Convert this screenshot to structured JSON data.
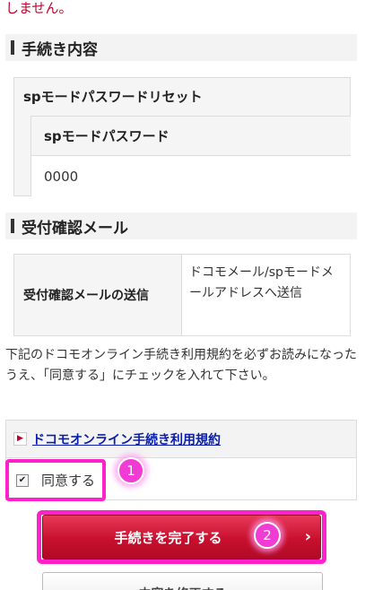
{
  "top_text": "しません。",
  "procedure_section": {
    "heading": "手続き内容",
    "item_title": "spモードパスワードリセット",
    "sub_title": "spモードパスワード",
    "sub_value": "0000"
  },
  "confirmation_section": {
    "heading": "受付確認メール",
    "label": "受付確認メールの送信",
    "value": "ドコモメール/spモードメールアドレスへ送信"
  },
  "terms": {
    "instruction": "下記のドコモオンライン手続き利用規約を必ずお読みになったうえ、「同意する」にチェックを入れて下さい。",
    "link_text": "ドコモオンライン手続き利用規約",
    "agree_label": "同意する",
    "agree_checked": true
  },
  "buttons": {
    "complete_label": "手続きを完了する",
    "modify_label": "内容を修正する"
  },
  "markers": {
    "step1": "1",
    "step2": "2"
  },
  "colors": {
    "highlight": "#ff22cc",
    "primary_button": "#c8102e",
    "link": "#0a1ea8"
  }
}
